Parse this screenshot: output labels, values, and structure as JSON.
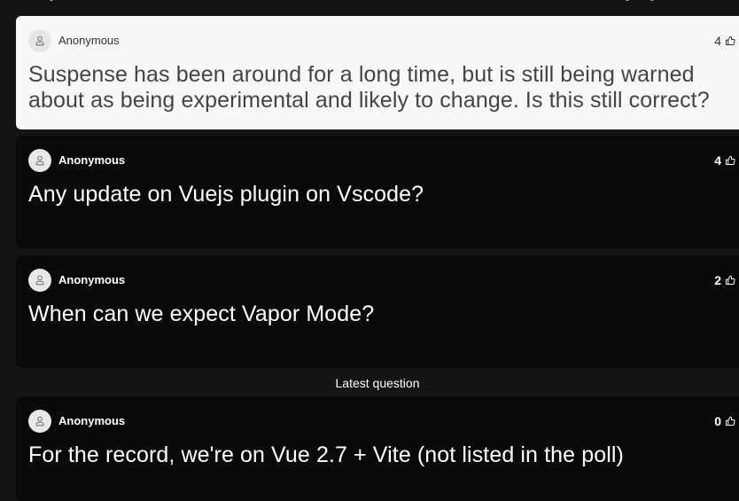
{
  "questions": [
    {
      "author": "Anonymous",
      "votes": "4",
      "text": "Suspense has been around for a long time, but is still being warned about as being experimental and likely to change. Is this still correct?",
      "selected": true
    },
    {
      "author": "Anonymous",
      "votes": "4",
      "text": "Any update on Vuejs plugin on Vscode?"
    },
    {
      "author": "Anonymous",
      "votes": "2",
      "text": "When can we expect Vapor Mode?"
    },
    {
      "author": "Anonymous",
      "votes": "0",
      "text": "For the record, we're on Vue 2.7 + Vite (not listed in the poll)"
    }
  ],
  "latest_label": "Latest question",
  "icons": {
    "avatar": "user-icon",
    "vote": "thumbs-up-icon"
  },
  "colors": {
    "background": "#141414",
    "card_dark": "#0a0a0a",
    "card_selected": "#f8f8f8",
    "text_light": "#ffffff"
  }
}
